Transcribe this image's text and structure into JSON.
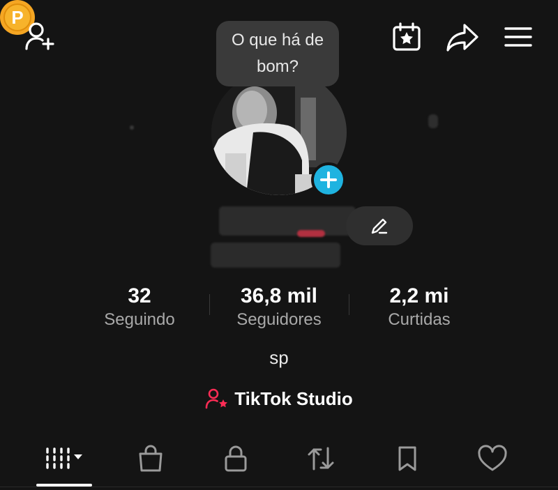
{
  "top_bar": {
    "add_friend_icon": "person-add-icon",
    "coin_icon": "coin-icon",
    "coin_letter": "P",
    "calendar_icon": "calendar-star-icon",
    "share_icon": "share-arrow-icon",
    "menu_icon": "hamburger-icon"
  },
  "bubble": {
    "text": "O que há de bom?"
  },
  "profile": {
    "avatar_add_icon": "plus-icon",
    "edit_icon": "pencil-icon"
  },
  "stats": [
    {
      "value": "32",
      "label": "Seguindo"
    },
    {
      "value": "36,8 mil",
      "label": "Seguidores"
    },
    {
      "value": "2,2 mi",
      "label": "Curtidas"
    }
  ],
  "bio": "sp",
  "studio": {
    "label": "TikTok Studio",
    "icon": "person-star-icon"
  },
  "tabs": [
    {
      "name": "videos",
      "icon": "grid-bars-dropdown-icon"
    },
    {
      "name": "shop",
      "icon": "shopping-bag-icon"
    },
    {
      "name": "private",
      "icon": "lock-icon"
    },
    {
      "name": "reposts",
      "icon": "repost-icon"
    },
    {
      "name": "saved",
      "icon": "bookmark-icon"
    },
    {
      "name": "liked",
      "icon": "heart-icon"
    }
  ],
  "colors": {
    "background": "#141414",
    "accent_blue": "#1fb3e0",
    "coin": "#f5a623",
    "studio_icon": "#fe2c55"
  }
}
